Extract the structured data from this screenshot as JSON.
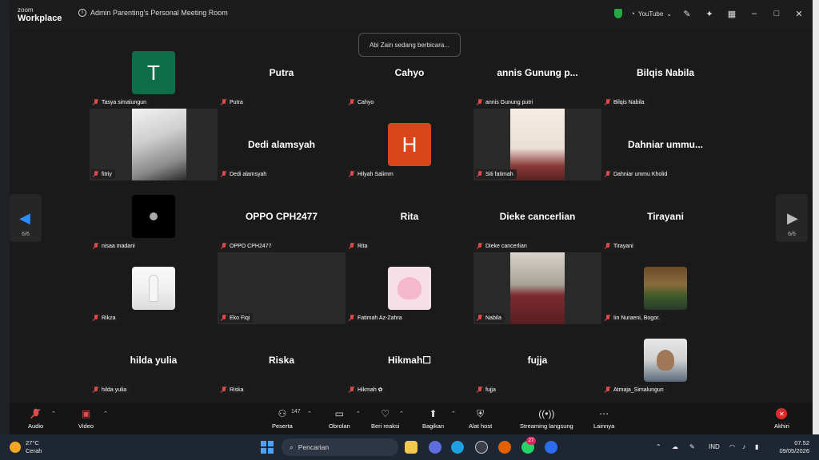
{
  "window": {
    "logo_line1": "zoom",
    "logo_line2": "Workplace",
    "meeting_title": "Admin Parenting's Personal Meeting Room",
    "youtube_label": "YouTube"
  },
  "speaking_banner": "Abi Zain sedang berbicara...",
  "pagination": {
    "left": "6/6",
    "right": "6/6"
  },
  "participants": [
    {
      "tile_name": "",
      "label": "Tasya simalungun",
      "avatar_letter": "T",
      "avatar_color": "#0e6e4a"
    },
    {
      "tile_name": "Putra",
      "label": "Putra"
    },
    {
      "tile_name": "Cahyo",
      "label": "Cahyo"
    },
    {
      "tile_name": "annis Gunung p...",
      "label": "annis Gunung putri"
    },
    {
      "tile_name": "Bilqis Nabila",
      "label": "Bilqis Nabila"
    },
    {
      "tile_name": "",
      "label": "fitriy",
      "video": true
    },
    {
      "tile_name": "Dedi alamsyah",
      "label": "Dedi alamsyah"
    },
    {
      "tile_name": "",
      "label": "Hilyah Salimm",
      "avatar_letter": "H",
      "avatar_color": "#d9461b"
    },
    {
      "tile_name": "",
      "label": "Siti fatimah",
      "video": true
    },
    {
      "tile_name": "Dahniar ummu...",
      "label": "Dahniar ummu Kholid"
    },
    {
      "tile_name": "",
      "label": "nisaa madani",
      "picture": true
    },
    {
      "tile_name": "OPPO CPH2477",
      "label": "OPPO CPH2477"
    },
    {
      "tile_name": "Rita",
      "label": "Rita"
    },
    {
      "tile_name": "Dieke cancerlian",
      "label": "Dieke cancerlian"
    },
    {
      "tile_name": "Tirayani",
      "label": "Tirayani"
    },
    {
      "tile_name": "",
      "label": "Rikza",
      "picture": true
    },
    {
      "tile_name": "",
      "label": "Eko Fiqi",
      "video": true
    },
    {
      "tile_name": "",
      "label": "Fatimah Az-Zahra",
      "picture": true
    },
    {
      "tile_name": "",
      "label": "Nabila",
      "video": true
    },
    {
      "tile_name": "",
      "label": "Iin Nuraeni, Bogor.",
      "picture": true
    },
    {
      "tile_name": "hilda yulia",
      "label": "hilda yulia"
    },
    {
      "tile_name": "Riska",
      "label": "Riska"
    },
    {
      "tile_name": "Hikmah☐",
      "label": "Hikmah ✿"
    },
    {
      "tile_name": "fujja",
      "label": "fujja"
    },
    {
      "tile_name": "",
      "label": "Atmaja_Simalungun",
      "picture": true
    }
  ],
  "controls": {
    "audio": "Audio",
    "video": "Video",
    "participants": "Peserta",
    "participant_count": "147",
    "chat": "Obrolan",
    "react": "Beri reaksi",
    "share": "Bagikan",
    "host_tools": "Alat host",
    "streaming": "Streaming langsung",
    "more": "Lainnya",
    "end": "Akhiri"
  },
  "taskbar": {
    "temperature": "27°C",
    "weather": "Cerah",
    "search_placeholder": "Pencarian",
    "whatsapp_badge": "27",
    "language": "IND",
    "time": "07.52",
    "date": "09/05/2026"
  }
}
